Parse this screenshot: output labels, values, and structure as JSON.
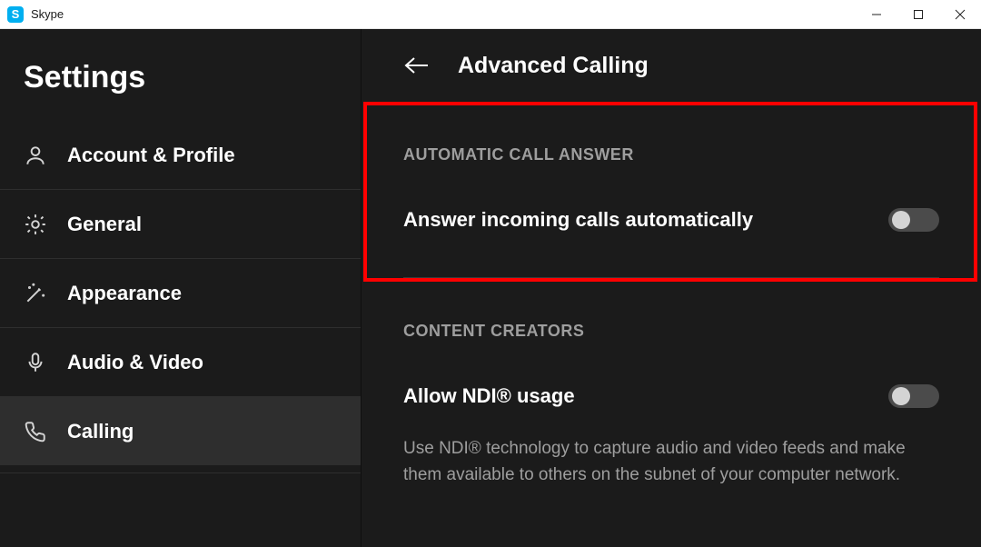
{
  "titlebar": {
    "app_name": "Skype"
  },
  "sidebar": {
    "title": "Settings",
    "items": [
      {
        "key": "account",
        "label": "Account & Profile",
        "active": false
      },
      {
        "key": "general",
        "label": "General",
        "active": false
      },
      {
        "key": "appearance",
        "label": "Appearance",
        "active": false
      },
      {
        "key": "audiovideo",
        "label": "Audio & Video",
        "active": false
      },
      {
        "key": "calling",
        "label": "Calling",
        "active": true
      }
    ]
  },
  "content": {
    "page_title": "Advanced Calling",
    "section1": {
      "heading": "AUTOMATIC CALL ANSWER",
      "row_title": "Answer incoming calls automatically",
      "toggle_on": false
    },
    "section2": {
      "heading": "CONTENT CREATORS",
      "row_title": "Allow NDI® usage",
      "toggle_on": false,
      "description": "Use NDI® technology to capture audio and video feeds and make them available to others on the subnet of your computer network."
    }
  }
}
